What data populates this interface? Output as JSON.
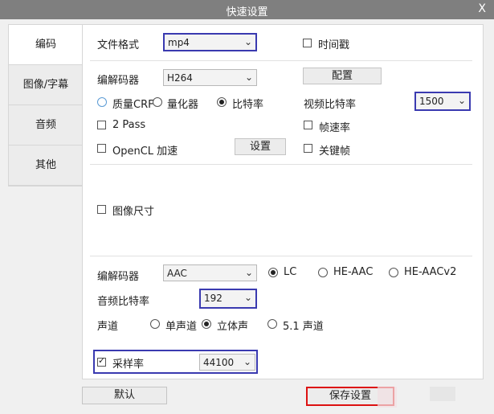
{
  "window": {
    "title": "快速设置",
    "close_label": "X"
  },
  "sidebar": {
    "tabs": [
      {
        "label": "编码"
      },
      {
        "label": "图像/字幕"
      },
      {
        "label": "音频"
      },
      {
        "label": "其他"
      }
    ]
  },
  "format": {
    "label": "文件格式",
    "value": "mp4"
  },
  "timestamp": {
    "label": "时间戳",
    "checked": false
  },
  "video": {
    "codec_label": "编解码器",
    "codec_value": "H264",
    "config_button": "配置",
    "quality_crf": "质量CRF",
    "quantizer": "量化器",
    "bitrate_mode": "比特率",
    "bitrate_label": "视频比特率",
    "bitrate_value": "1500",
    "two_pass": "2 Pass",
    "framerate": "帧速率",
    "opencl": "OpenCL 加速",
    "settings_button": "设置",
    "keyframe": "关键帧"
  },
  "image": {
    "size_label": "图像尺寸"
  },
  "audio": {
    "codec_label": "编解码器",
    "codec_value": "AAC",
    "lc": "LC",
    "he_aac": "HE-AAC",
    "he_aacv2": "HE-AACv2",
    "bitrate_label": "音频比特率",
    "bitrate_value": "192",
    "channel_label": "声道",
    "mono": "单声道",
    "stereo": "立体声",
    "surround": "5.1 声道",
    "samplerate_label": "采样率",
    "samplerate_value": "44100",
    "samplerate_checked": true
  },
  "footer": {
    "default_button": "默认",
    "save_button": "保存设置"
  },
  "colors": {
    "highlight_blue": "#3a3ab0",
    "highlight_red": "#dd1111",
    "titlebar": "#7f7f7f"
  }
}
